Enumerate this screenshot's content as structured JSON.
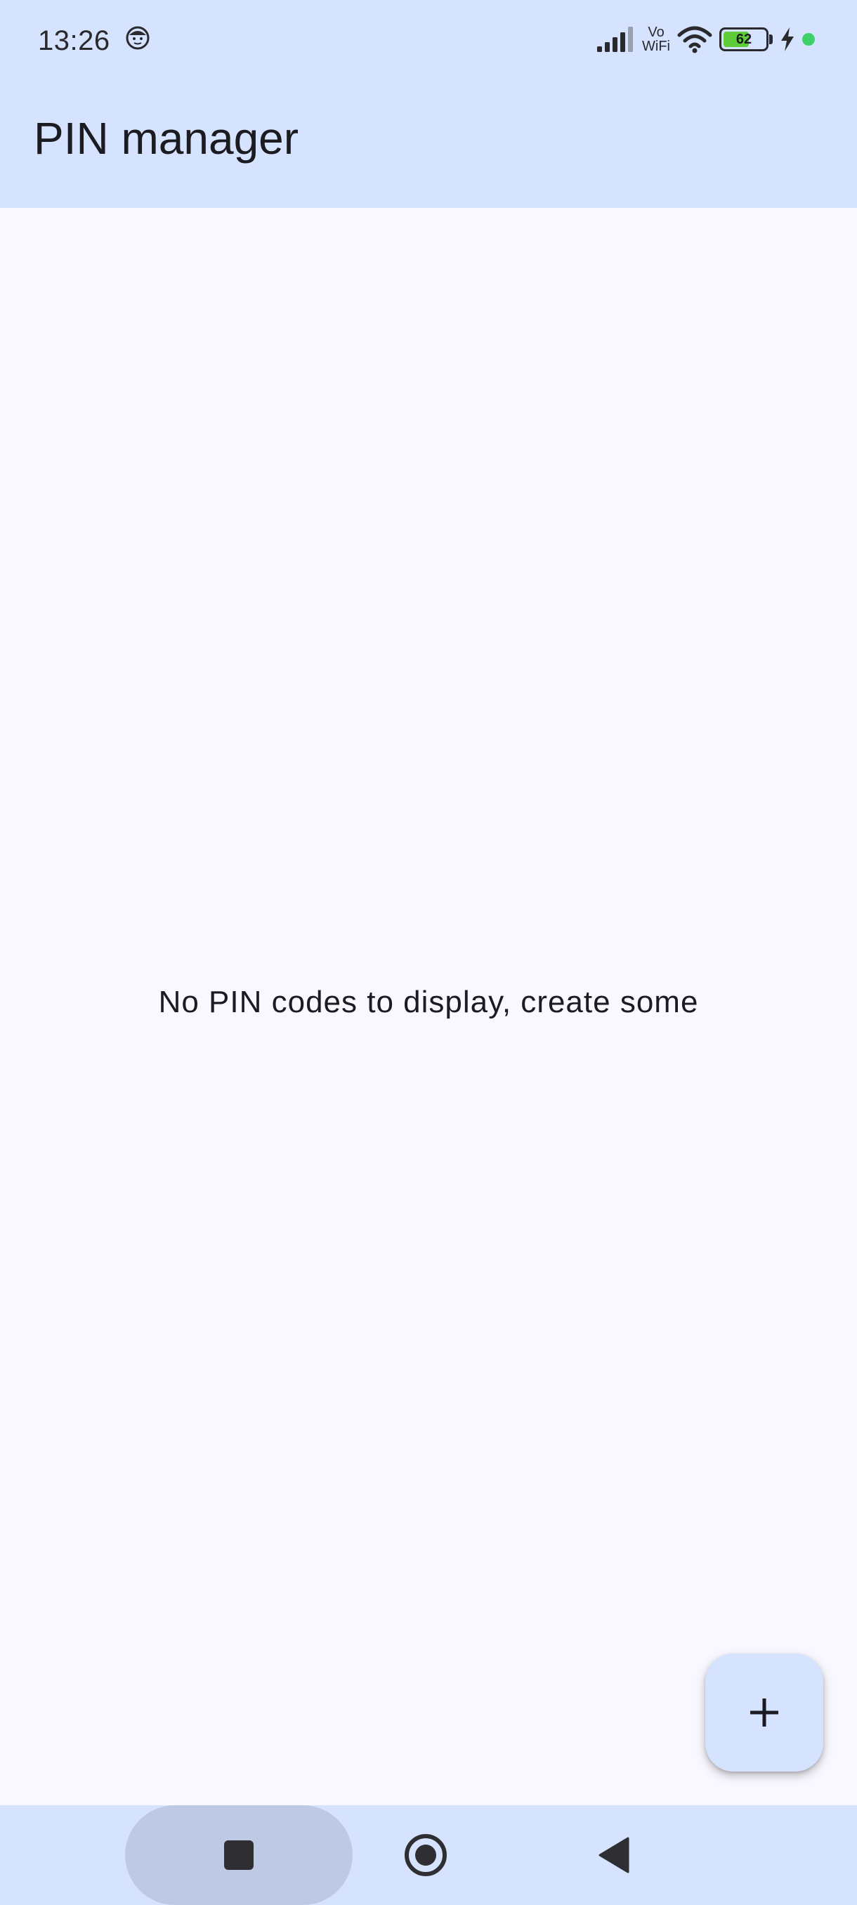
{
  "status_bar": {
    "time": "13:26",
    "vowifi_top": "Vo",
    "vowifi_bottom": "WiFi",
    "battery_level": "62",
    "battery_fraction": 0.62,
    "icons": [
      "face-icon",
      "signal-icon",
      "wifi-icon",
      "battery-icon",
      "charging-bolt-icon",
      "notification-dot-icon"
    ]
  },
  "app_bar": {
    "title": "PIN manager"
  },
  "main": {
    "empty_message": "No PIN codes to display, create some"
  },
  "fab": {
    "icon": "plus-icon"
  },
  "nav_bar": {
    "icons": [
      "recents-square-icon",
      "home-circle-icon",
      "back-triangle-icon"
    ]
  },
  "colors": {
    "bar_background": "#D6E3FF",
    "page_background": "#F9F8FF",
    "text": "#1B1B21",
    "nav_pill": "#BECAE4",
    "battery_fill": "#5FCC3A",
    "notification_dot": "#3ED16A"
  }
}
